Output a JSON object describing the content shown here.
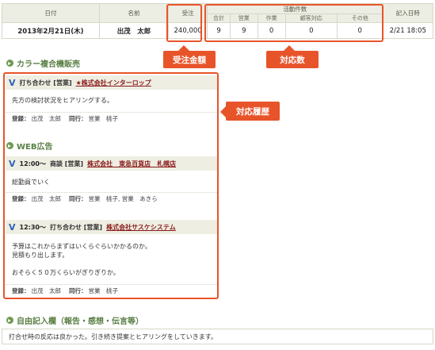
{
  "summary": {
    "headers": {
      "date": "日付",
      "name": "名前",
      "orders": "受注",
      "activity_group": "活動件数",
      "recorded": "記入日時"
    },
    "activity_sub": [
      "合計",
      "営業",
      "作業",
      "顧客対応",
      "その他"
    ],
    "row": {
      "date": "2013年2月21日(木)",
      "name": "出茂　太郎",
      "orders": "240,000",
      "activity": [
        "9",
        "9",
        "0",
        "0",
        "0"
      ],
      "recorded": "2/21 18:05"
    }
  },
  "callouts": {
    "orders_amount": "受注金額",
    "count": "対応数",
    "history": "対応履歴"
  },
  "sections": [
    {
      "title": "カラー複合機販売",
      "entries": [
        {
          "time": "",
          "kind": "打ち合わせ [営業]",
          "company": "★株式会社インターロップ",
          "body": [
            "先方の検討状況をヒアリングする。"
          ],
          "reg_label": "登録：",
          "reg": "出茂　太郎",
          "with_label": "同行：",
          "with": "営業　桃子"
        }
      ]
    },
    {
      "title": "WEB広告",
      "entries": [
        {
          "time": "12:00～",
          "kind": "商談 [営業]",
          "company": "株式会社　東急百貨店　札幌店",
          "body": [
            "総勤員でいく"
          ],
          "reg_label": "登録：",
          "reg": "出茂　太郎",
          "with_label": "同行：",
          "with": "営業　桃子, 営業　あきら"
        },
        {
          "time": "12:30～",
          "kind": "打ち合わせ [営業]",
          "company": "株式会社サスケシステム",
          "body": [
            "予算はこれからまずはいくらぐらいかかるのか。",
            "見積もり出します。",
            "",
            "おそらく５０万くらいがぎりぎりか。"
          ],
          "reg_label": "登録：",
          "reg": "出茂　太郎",
          "with_label": "同行：",
          "with": "営業　桃子"
        }
      ]
    }
  ],
  "free": {
    "title": "自由記入欄（報告・感想・伝言等）",
    "text": "打合せ時の反応は良かった。引き続き提案とヒアリングをしていきます。"
  },
  "colors": {
    "accent": "#e8542a",
    "section_green": "#5a7f45",
    "link": "#8a1a1a",
    "header_bg": "#ecede3"
  }
}
